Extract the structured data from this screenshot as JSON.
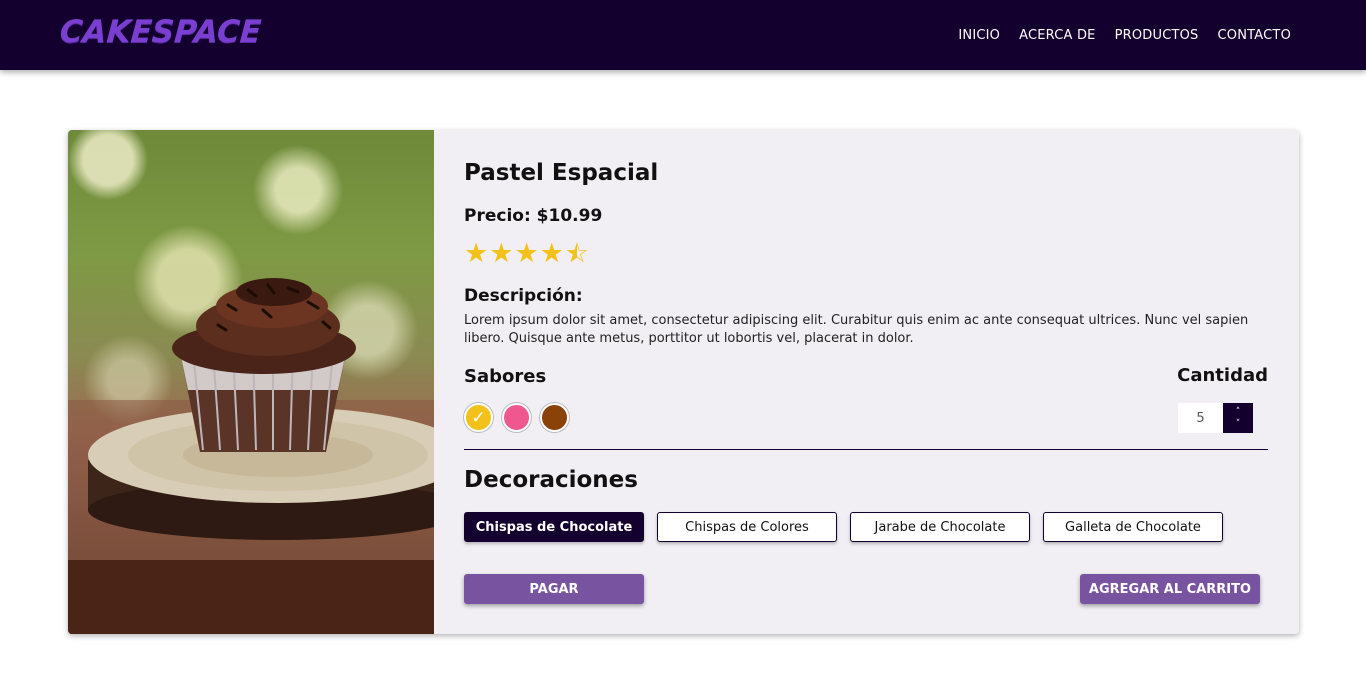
{
  "brand": {
    "name": "CAKESPACE",
    "color": "#7a3fd1"
  },
  "nav": {
    "items": [
      "INICIO",
      "ACERCA DE",
      "PRODUCTOS",
      "CONTACTO"
    ]
  },
  "product": {
    "title": "Pastel Espacial",
    "price_label": "Precio: $10.99",
    "rating": 4.5,
    "rating_max": 5,
    "image": "cupcake-photo",
    "description_label": "Descripción:",
    "description": "Lorem ipsum dolor sit amet, consectetur adipiscing elit. Curabitur quis enim ac ante consequat ultrices. Nunc vel sapien libero. Quisque ante metus, porttitor ut lobortis vel, placerat in dolor."
  },
  "flavors": {
    "label": "Sabores",
    "options": [
      {
        "color": "#f2c21b",
        "selected": true
      },
      {
        "color": "#f0578f",
        "selected": false
      },
      {
        "color": "#8a4208",
        "selected": false
      }
    ]
  },
  "quantity": {
    "label": "Cantidad",
    "value": "5"
  },
  "decorations": {
    "label": "Decoraciones",
    "options": [
      {
        "label": "Chispas de Chocolate",
        "selected": true
      },
      {
        "label": "Chispas de Colores",
        "selected": false
      },
      {
        "label": "Jarabe de Chocolate",
        "selected": false
      },
      {
        "label": "Galleta de Chocolate",
        "selected": false
      }
    ]
  },
  "actions": {
    "pay_label": "PAGAR",
    "cart_label": "AGREGAR AL CARRITO"
  },
  "colors": {
    "navbar": "#14002e",
    "card": "#f1eff4",
    "accent_button": "#7753a0",
    "star": "#f2c21b"
  }
}
